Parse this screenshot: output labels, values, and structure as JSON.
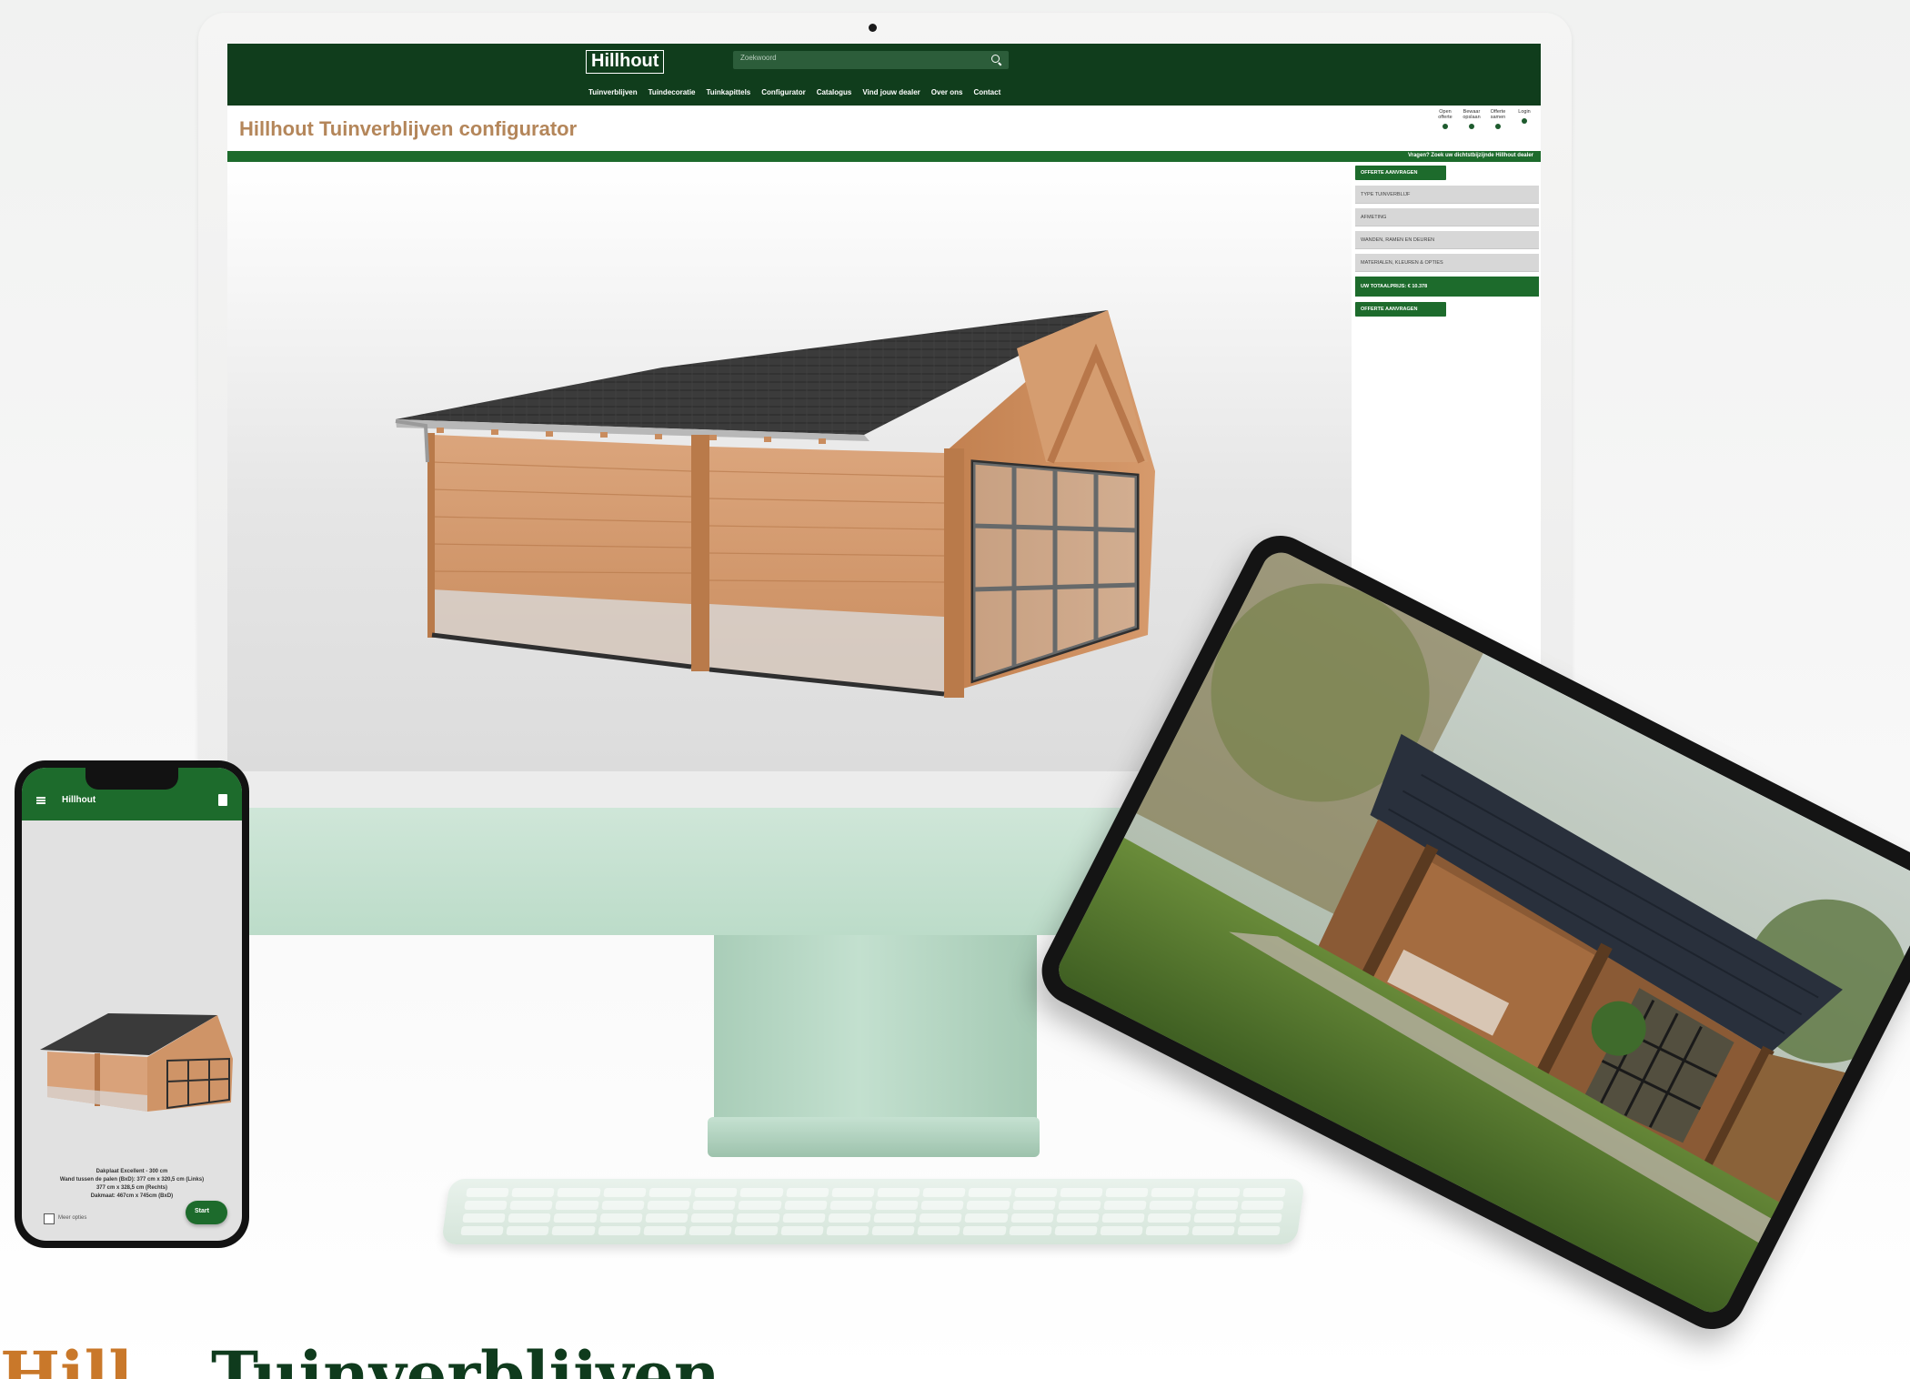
{
  "site": {
    "logo": "Hillhout",
    "search_placeholder": "Zoekwoord",
    "menu": [
      "Tuinverblijven",
      "Tuindecoratie",
      "Tuinkapittels",
      "Configurator",
      "Catalogus",
      "Vind jouw dealer",
      "Over ons",
      "Contact"
    ]
  },
  "configurator": {
    "title": "Hillhout Tuinverblijven configurator",
    "header_actions": [
      "Open offerte",
      "Bewaar opslaan",
      "Offerte samen",
      "Login"
    ],
    "help_text": "Vragen? Zoek uw dichtstbijzijnde Hillhout dealer",
    "quote_button": "OFFERTE AANVRAGEN",
    "sections": [
      "TYPE TUINVERBLIJF",
      "AFMETING",
      "WANDEN, RAMEN EN DEUREN",
      "MATERIALEN, KLEUREN & OPTIES"
    ],
    "total": "UW TOTAALPRIJS: € 10.378",
    "quote_button_bottom": "OFFERTE AANVRAGEN"
  },
  "phone": {
    "app_title": "Hillhout",
    "info_lines": [
      "Dakplaat Excellent - 300 cm",
      "Wand tussen de palen (BxD): 377 cm x 320,5 cm (Links)",
      "377 cm x 328,5 cm (Rechts)",
      "Dakmaat: 467cm x 745cm (BxD)"
    ],
    "checkbox_label": "Meer opties",
    "fab_label": "Start"
  },
  "headline": {
    "brand": "Hill",
    "word": "Tuinverblijven"
  },
  "colors": {
    "nav_dark_green": "#103d1c",
    "accent_green": "#1d6b2c",
    "title_brown": "#b4865a",
    "imac_green": "#bcdcc9",
    "headline_orange": "#c9782a"
  }
}
